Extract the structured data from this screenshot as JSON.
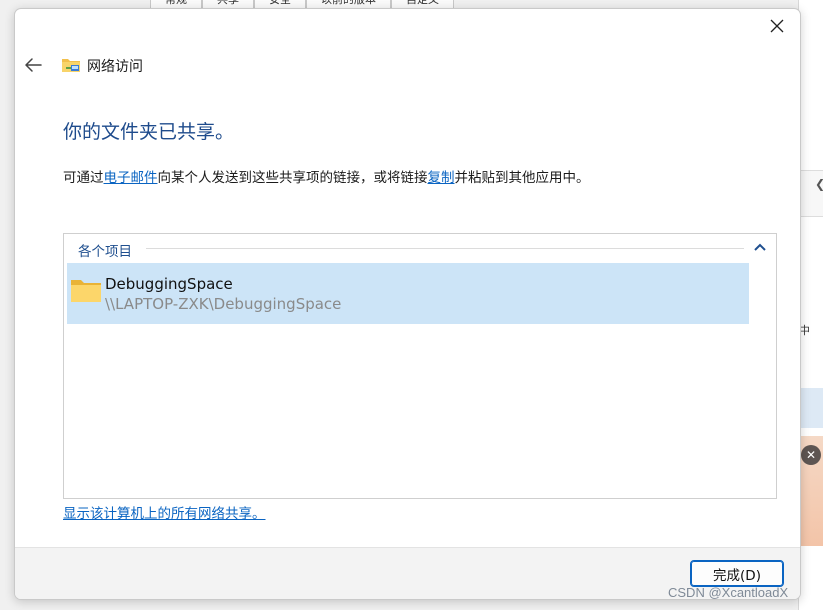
{
  "background": {
    "tabs": [
      "常规",
      "共享",
      "安全",
      "以前的版本",
      "自定义"
    ],
    "side_char": "中"
  },
  "dialog": {
    "title": "网络访问",
    "heading": "你的文件夹已共享。",
    "description": {
      "part1": "可通过",
      "link_email": "电子邮件",
      "part2": "向某个人发送到这些共享项的链接，或将链接",
      "link_copy": "复制",
      "part3": "并粘贴到其他应用中。"
    },
    "group": {
      "label": "各个项目",
      "items": [
        {
          "name": "DebuggingSpace",
          "path": "\\\\LAPTOP-ZXK\\DebuggingSpace"
        }
      ]
    },
    "show_all_link": "显示该计算机上的所有网络共享。",
    "finish_button": "完成(D)"
  },
  "watermark": "CSDN @XcantloadX",
  "colors": {
    "accent": "#0a64c2",
    "heading": "#1e4b8c",
    "selection": "#cce4f7"
  },
  "icons": [
    "close-icon",
    "back-arrow-icon",
    "network-folder-icon",
    "chevron-up-icon",
    "folder-icon",
    "photo-close-icon"
  ]
}
